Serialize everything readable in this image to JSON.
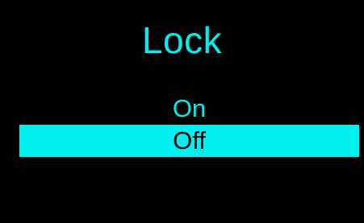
{
  "screen": {
    "title": "Lock",
    "accent_color": "#00f0f0",
    "background_color": "#000000"
  },
  "menu": {
    "items": [
      {
        "label": "On",
        "selected": false
      },
      {
        "label": "Off",
        "selected": true
      }
    ]
  }
}
